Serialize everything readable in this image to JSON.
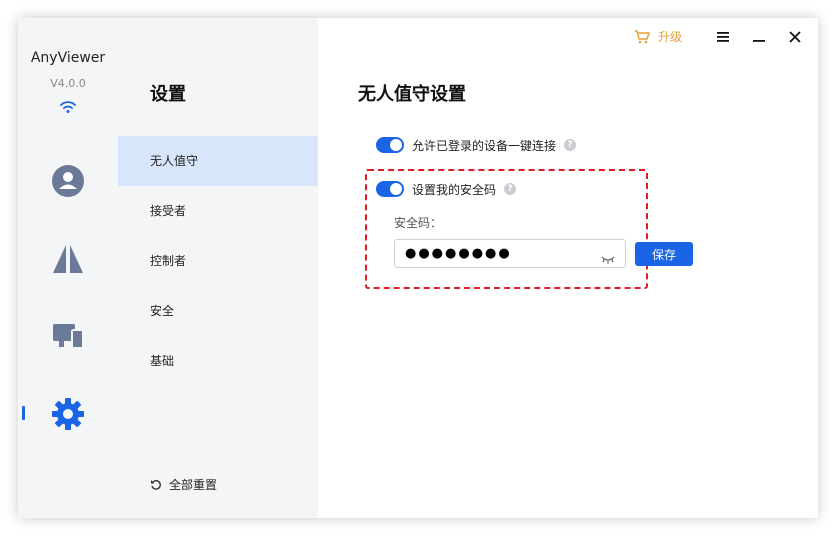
{
  "app": {
    "name": "AnyViewer",
    "version": "V4.0.0"
  },
  "titlebar": {
    "upgrade_label": "升级"
  },
  "menu": {
    "title": "设置",
    "items": [
      {
        "label": "无人值守",
        "active": true
      },
      {
        "label": "接受者"
      },
      {
        "label": "控制者"
      },
      {
        "label": "安全"
      },
      {
        "label": "基础"
      }
    ],
    "reset_label": "全部重置"
  },
  "main": {
    "title": "无人值守设置",
    "options": [
      {
        "label": "允许已登录的设备一键连接",
        "enabled": true
      },
      {
        "label": "设置我的安全码",
        "enabled": true
      }
    ],
    "security_code": {
      "label": "安全码：",
      "value": "●●●●●●●●"
    },
    "save_label": "保存"
  },
  "colors": {
    "accent": "#1a64e6",
    "upgrade": "#e3a13a",
    "highlight_box": "#e01b24",
    "active_menu_bg": "#d8e6fb",
    "rail_icon": "#6b7a99"
  }
}
